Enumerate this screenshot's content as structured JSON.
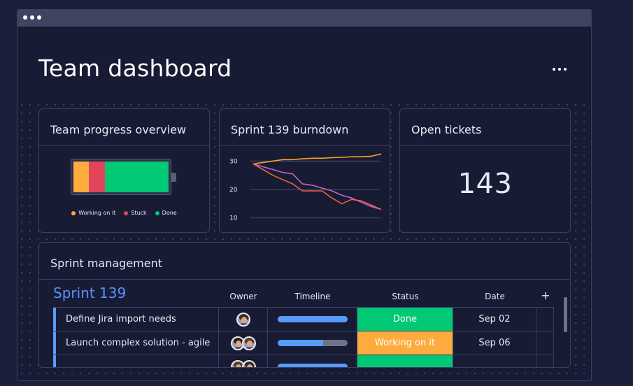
{
  "window": {
    "titlebar_dots": 3
  },
  "header": {
    "title": "Team dashboard",
    "more_icon": "more-horizontal-icon"
  },
  "cards": {
    "progress": {
      "title": "Team progress overview",
      "segments": [
        {
          "label": "Working on it",
          "fraction": 0.16,
          "color": "#fdab3d"
        },
        {
          "label": "Stuck",
          "fraction": 0.17,
          "color": "#e2445c"
        },
        {
          "label": "Done",
          "fraction": 0.67,
          "color": "#00c875"
        }
      ]
    },
    "burndown": {
      "title": "Sprint 139 burndown"
    },
    "tickets": {
      "title": "Open tickets",
      "value": "143"
    }
  },
  "chart_data": {
    "type": "line",
    "yticks": [
      "30",
      "20",
      "10"
    ],
    "ylim": [
      5,
      35
    ],
    "grid": true,
    "x": [
      0,
      1,
      2,
      3,
      4,
      5,
      6,
      7,
      8,
      9,
      10,
      11,
      12,
      13
    ],
    "series": [
      {
        "color": "#f5a623",
        "values": [
          29,
          29.5,
          30,
          30.5,
          30.5,
          30.8,
          31,
          31,
          31.2,
          31.3,
          31.5,
          31.5,
          31.7,
          32.5
        ]
      },
      {
        "color": "#c262c9",
        "values": [
          29,
          28,
          27,
          26,
          25.5,
          22,
          21.5,
          20.5,
          19.5,
          18,
          17,
          15.5,
          14,
          13
        ]
      },
      {
        "color": "#e8633a",
        "values": [
          29,
          27,
          25,
          23.5,
          22,
          19.5,
          19.5,
          19.5,
          17,
          15,
          16.5,
          16,
          14.5,
          13
        ]
      }
    ]
  },
  "sprint": {
    "section_title": "Sprint management",
    "name": "Sprint 139",
    "add_icon": "plus-icon",
    "columns": {
      "owner": "Owner",
      "timeline": "Timeline",
      "status": "Status",
      "date": "Date"
    },
    "rows": [
      {
        "task": "Define Jira import needs",
        "owners": 1,
        "timeline_progress": 1.0,
        "status": "Done",
        "status_color": "#00c875",
        "date": "Sep 02"
      },
      {
        "task": "Launch complex solution - agile",
        "owners": 2,
        "timeline_progress": 0.65,
        "status": "Working on it",
        "status_color": "#fdab3d",
        "date": "Sep 06"
      },
      {
        "task": "",
        "owners": 2,
        "timeline_progress": 1.0,
        "status": "",
        "status_color": "#00c875",
        "date": ""
      }
    ]
  }
}
